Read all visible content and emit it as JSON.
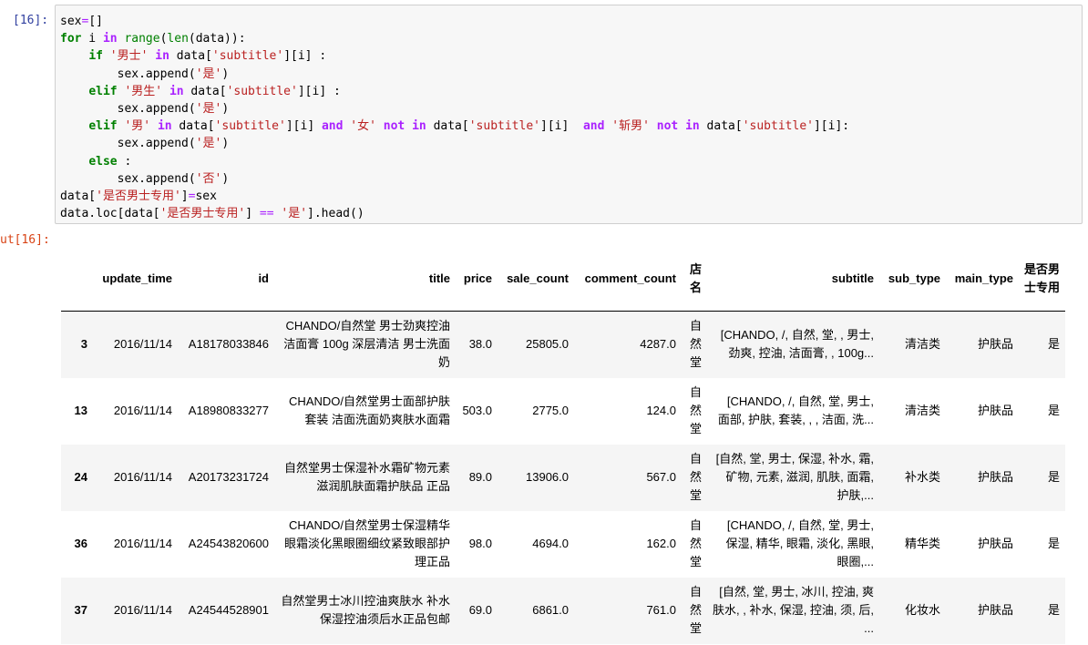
{
  "input_prompt": "[16]:",
  "output_prompt": "ut[16]:",
  "table": {
    "columns": [
      "",
      "update_time",
      "id",
      "title",
      "price",
      "sale_count",
      "comment_count",
      "店名",
      "subtitle",
      "sub_type",
      "main_type",
      "是否男士专用"
    ],
    "rows": [
      {
        "index": "3",
        "update_time": "2016/11/14",
        "id": "A18178033846",
        "title": "CHANDO/自然堂 男士劲爽控油洁面膏 100g 深层清洁 男士洗面奶",
        "price": "38.0",
        "sale_count": "25805.0",
        "comment_count": "4287.0",
        "shop": "自然堂",
        "subtitle": "[CHANDO, /, 自然, 堂, , 男士, 劲爽, 控油, 洁面膏, , 100g...",
        "sub_type": "清洁类",
        "main_type": "护肤品",
        "is_men": "是"
      },
      {
        "index": "13",
        "update_time": "2016/11/14",
        "id": "A18980833277",
        "title": "CHANDO/自然堂男士面部护肤套装 洁面洗面奶爽肤水面霜",
        "price": "503.0",
        "sale_count": "2775.0",
        "comment_count": "124.0",
        "shop": "自然堂",
        "subtitle": "[CHANDO, /, 自然, 堂, 男士, 面部, 护肤, 套装, , , 洁面, 洗...",
        "sub_type": "清洁类",
        "main_type": "护肤品",
        "is_men": "是"
      },
      {
        "index": "24",
        "update_time": "2016/11/14",
        "id": "A20173231724",
        "title": "自然堂男士保湿补水霜矿物元素滋润肌肤面霜护肤品 正品",
        "price": "89.0",
        "sale_count": "13906.0",
        "comment_count": "567.0",
        "shop": "自然堂",
        "subtitle": "[自然, 堂, 男士, 保湿, 补水, 霜, 矿物, 元素, 滋润, 肌肤, 面霜, 护肤,...",
        "sub_type": "补水类",
        "main_type": "护肤品",
        "is_men": "是"
      },
      {
        "index": "36",
        "update_time": "2016/11/14",
        "id": "A24543820600",
        "title": "CHANDO/自然堂男士保湿精华眼霜淡化黑眼圈细纹紧致眼部护理正品",
        "price": "98.0",
        "sale_count": "4694.0",
        "comment_count": "162.0",
        "shop": "自然堂",
        "subtitle": "[CHANDO, /, 自然, 堂, 男士, 保湿, 精华, 眼霜, 淡化, 黑眼, 眼圈,...",
        "sub_type": "精华类",
        "main_type": "护肤品",
        "is_men": "是"
      },
      {
        "index": "37",
        "update_time": "2016/11/14",
        "id": "A24544528901",
        "title": "自然堂男士冰川控油爽肤水 补水保湿控油须后水正品包邮",
        "price": "69.0",
        "sale_count": "6861.0",
        "comment_count": "761.0",
        "shop": "自然堂",
        "subtitle": "[自然, 堂, 男士, 冰川, 控油, 爽肤水, , 补水, 保湿, 控油, 须, 后, ...",
        "sub_type": "化妆水",
        "main_type": "护肤品",
        "is_men": "是"
      }
    ]
  }
}
